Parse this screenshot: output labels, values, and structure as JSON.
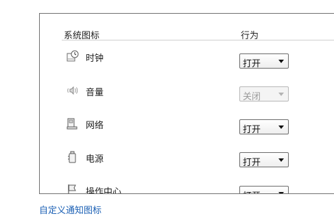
{
  "header": {
    "col_icon": "系统图标",
    "col_behavior": "行为"
  },
  "rows": [
    {
      "icon": "clock-icon",
      "label": "时钟",
      "value": "打开",
      "enabled": true
    },
    {
      "icon": "speaker-icon",
      "label": "音量",
      "value": "关闭",
      "enabled": false
    },
    {
      "icon": "network-icon",
      "label": "网络",
      "value": "打开",
      "enabled": true
    },
    {
      "icon": "power-icon",
      "label": "电源",
      "value": "打开",
      "enabled": true
    },
    {
      "icon": "flag-icon",
      "label": "操作中心",
      "value": "打开",
      "enabled": true
    }
  ],
  "footer": {
    "link": "自定义通知图标"
  }
}
